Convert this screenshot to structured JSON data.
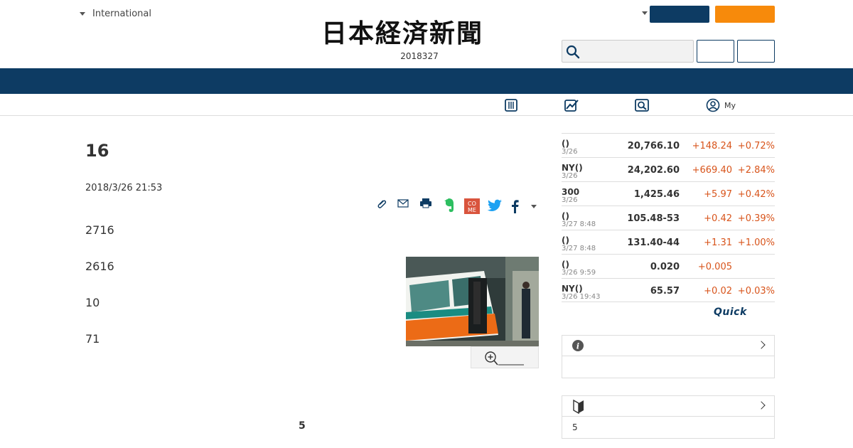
{
  "header": {
    "edition_label": "International",
    "logo_text": "日本経済新聞",
    "date": "2018327"
  },
  "subnav": {
    "my_label": "My"
  },
  "article": {
    "title": "16",
    "published": "2018/3/26 21:53",
    "paragraphs": [
      "2716",
      "2616",
      "10",
      "71"
    ],
    "footer_number": "5"
  },
  "market": {
    "rows": [
      {
        "name": "()",
        "time": "3/26",
        "value": "20,766.10",
        "change": "+148.24",
        "pct": "+0.72%"
      },
      {
        "name": "NY()",
        "time": "3/26",
        "value": "24,202.60",
        "change": "+669.40",
        "pct": "+2.84%"
      },
      {
        "name": "300",
        "time": "3/26",
        "value": "1,425.46",
        "change": "+5.97",
        "pct": "+0.42%"
      },
      {
        "name": "()",
        "time": "3/27 8:48",
        "value": "105.48-53",
        "change": "+0.42",
        "pct": "+0.39%"
      },
      {
        "name": "()",
        "time": "3/27 8:48",
        "value": "131.40-44",
        "change": "+1.31",
        "pct": "+1.00%"
      },
      {
        "name": "()",
        "time": "3/26 9:59",
        "value": "0.020",
        "change": "+0.005",
        "pct": ""
      },
      {
        "name": "NY()",
        "time": "3/26 19:43",
        "value": "65.57",
        "change": "+0.02",
        "pct": "+0.03%"
      }
    ],
    "provider": "Quick"
  },
  "sidebox2": {
    "body": "5"
  },
  "colors": {
    "navy": "#0d3b63",
    "orange": "#f78a0b",
    "positive": "#d8541b"
  }
}
